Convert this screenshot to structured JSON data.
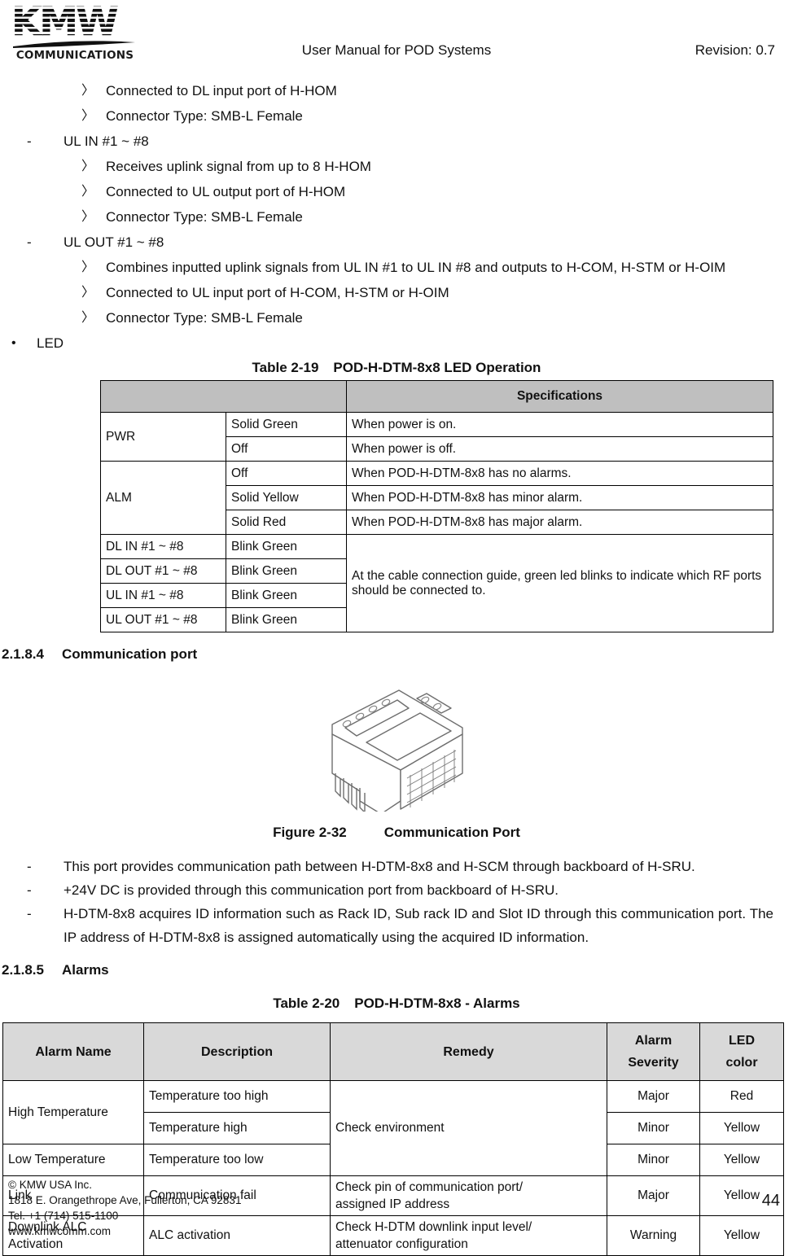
{
  "header": {
    "logo_letters": "KMW",
    "logo_sub": "COMMUNICATIONS",
    "title": "User Manual for POD Systems",
    "revision": "Revision: 0.7"
  },
  "bullets": [
    {
      "level": 3,
      "marker": "〉",
      "text": "Connected to DL input port of H-HOM"
    },
    {
      "level": 3,
      "marker": "〉",
      "text": "Connector Type: SMB-L Female"
    },
    {
      "level": 2,
      "marker": "-",
      "text": "UL IN #1 ~ #8"
    },
    {
      "level": 3,
      "marker": "〉",
      "text": "Receives uplink signal from up to 8 H-HOM"
    },
    {
      "level": 3,
      "marker": "〉",
      "text": "Connected to UL output port of H-HOM"
    },
    {
      "level": 3,
      "marker": "〉",
      "text": "Connector Type: SMB-L Female"
    },
    {
      "level": 2,
      "marker": "-",
      "text": "UL OUT #1 ~ #8"
    },
    {
      "level": 3,
      "marker": "〉",
      "text": "Combines inputted uplink signals from UL IN #1 to UL IN #8 and outputs to H-COM, H-STM or H-OIM"
    },
    {
      "level": 3,
      "marker": "〉",
      "text": "Connected to UL input port of H-COM, H-STM or H-OIM"
    },
    {
      "level": 3,
      "marker": "〉",
      "text": "Connector Type: SMB-L Female"
    },
    {
      "level": 1,
      "marker": "•",
      "text": "LED"
    }
  ],
  "table_2_19": {
    "caption_label": "Table 2-19",
    "caption_title": "POD-H-DTM-8x8 LED Operation",
    "header": [
      "",
      "",
      "Specifications"
    ],
    "rows": [
      {
        "name": "PWR",
        "name_rowspan": 2,
        "state": "Solid Green",
        "spec": "When power is on.",
        "spec_rowspan": 1
      },
      {
        "name": null,
        "state": "Off",
        "spec": "When power is off.",
        "spec_rowspan": 1
      },
      {
        "name": "ALM",
        "name_rowspan": 3,
        "state": "Off",
        "spec": "When POD-H-DTM-8x8 has no alarms.",
        "spec_rowspan": 1
      },
      {
        "name": null,
        "state": "Solid Yellow",
        "spec": "When POD-H-DTM-8x8 has minor alarm.",
        "spec_rowspan": 1
      },
      {
        "name": null,
        "state": "Solid Red",
        "spec": "When POD-H-DTM-8x8 has major alarm.",
        "spec_rowspan": 1
      },
      {
        "name": "DL IN #1 ~ #8",
        "name_rowspan": 1,
        "state": "Blink Green",
        "spec": "At the cable connection guide, green led blinks to indicate which RF ports should be connected to.",
        "spec_rowspan": 4
      },
      {
        "name": "DL OUT #1 ~ #8",
        "name_rowspan": 1,
        "state": "Blink Green",
        "spec": null
      },
      {
        "name": "UL IN #1 ~ #8",
        "name_rowspan": 1,
        "state": "Blink Green",
        "spec": null
      },
      {
        "name": "UL OUT #1 ~ #8",
        "name_rowspan": 1,
        "state": "Blink Green",
        "spec": null
      }
    ]
  },
  "section_comm": {
    "number": "2.1.8.4",
    "title": "Communication port",
    "figure_label": "Figure 2-32",
    "figure_title": "Communication Port",
    "paragraphs": [
      {
        "marker": "-",
        "text": "This port provides communication path between H-DTM-8x8 and H-SCM through backboard of H-SRU."
      },
      {
        "marker": "-",
        "text": "+24V DC is provided through this communication port from backboard of H-SRU."
      },
      {
        "marker": "-",
        "text": "H-DTM-8x8 acquires ID information such as Rack ID, Sub rack ID and Slot ID through this communication port. The IP address of H-DTM-8x8 is assigned automatically using the acquired ID information."
      }
    ]
  },
  "section_alarms": {
    "number": "2.1.8.5",
    "title": "Alarms"
  },
  "table_2_20": {
    "caption_label": "Table 2-20",
    "caption_title": "POD-H-DTM-8x8 - Alarms",
    "header": [
      "Alarm Name",
      "Description",
      "Remedy",
      "Alarm\nSeverity",
      "LED\ncolor"
    ],
    "header_cells": [
      {
        "line1": "Alarm Name",
        "line2": ""
      },
      {
        "line1": "Description",
        "line2": ""
      },
      {
        "line1": "Remedy",
        "line2": ""
      },
      {
        "line1": "Alarm",
        "line2": "Severity"
      },
      {
        "line1": "LED",
        "line2": "color"
      }
    ],
    "rows": [
      {
        "alarm_name": "High Temperature",
        "name_rowspan": 2,
        "description": "Temperature too high",
        "remedy": "Check environment",
        "remedy_rowspan": 3,
        "severity": "Major",
        "led_color": "Red"
      },
      {
        "alarm_name": null,
        "description": "Temperature high",
        "remedy": null,
        "severity": "Minor",
        "led_color": "Yellow"
      },
      {
        "alarm_name": "Low Temperature",
        "name_rowspan": 1,
        "description": "Temperature too low",
        "remedy": null,
        "severity": "Minor",
        "led_color": "Yellow"
      },
      {
        "alarm_name": "Link",
        "name_rowspan": 1,
        "description": "Communication fail",
        "remedy": "Check pin of communication port/ assigned IP address",
        "remedy_rowspan": 1,
        "remedy_l1": "Check pin of communication port/",
        "remedy_l2": "assigned IP address",
        "severity": "Major",
        "led_color": "Yellow"
      },
      {
        "alarm_name": "Downlink ALC Activation",
        "name_rowspan": 1,
        "name_l1": "Downlink ALC",
        "name_l2": "Activation",
        "description": "ALC activation",
        "remedy": "Check H-DTM downlink input level/ attenuator configuration",
        "remedy_rowspan": 1,
        "remedy_l1": "Check H-DTM downlink input level/",
        "remedy_l2": "attenuator configuration",
        "severity": "Warning",
        "led_color": "Yellow"
      }
    ]
  },
  "footer": {
    "line1": "© KMW USA Inc.",
    "line2": "1818 E. Orangethrope Ave, Fullerton, CA 92831",
    "line3": "Tel. +1 (714) 515-1100",
    "line4": "www.kmwcomm.com",
    "page_number": "44"
  },
  "colors": {
    "header_gray_t19": "#bfbfbf",
    "header_gray_t20": "#d9d9d9",
    "text": "#111111",
    "border": "#000000"
  }
}
